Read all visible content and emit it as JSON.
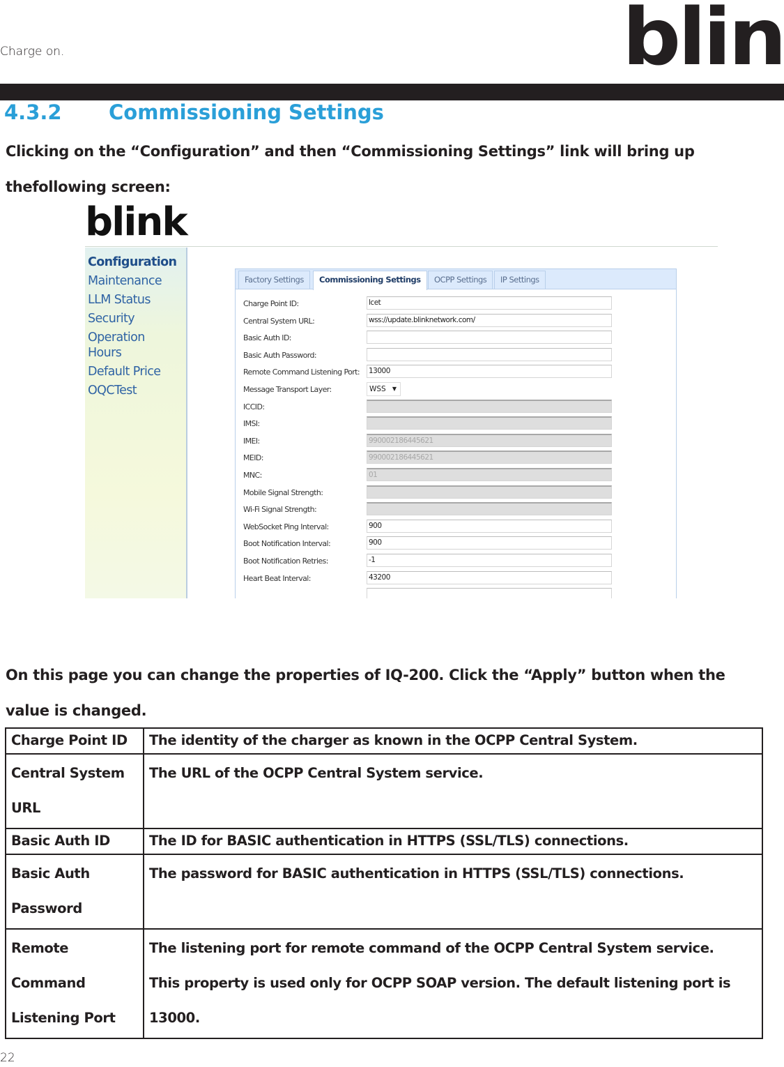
{
  "header": {
    "tagline": "Charge on.",
    "logo_text": "blink",
    "brand_color": "#2a9fd8",
    "bar_color": "#231f20"
  },
  "section": {
    "number": "4.3.2",
    "title": "Commissioning Settings"
  },
  "intro": {
    "line1": "Clicking on the “Configuration” and then “Commissioning Settings” link will bring up",
    "line2": "thefollowing screen:"
  },
  "screenshot": {
    "logo_text": "blink",
    "sidebar": {
      "items": [
        {
          "label": "Configuration",
          "active": true
        },
        {
          "label": "Maintenance"
        },
        {
          "label": "LLM Status"
        },
        {
          "label": "Security"
        },
        {
          "label": "Operation Hours"
        },
        {
          "label": "Default Price"
        },
        {
          "label": "OQCTest"
        }
      ]
    },
    "tabs": [
      {
        "label": "Factory Settings"
      },
      {
        "label": "Commissioning Settings",
        "active": true
      },
      {
        "label": "OCPP Settings"
      },
      {
        "label": "IP Settings"
      }
    ],
    "fields": [
      {
        "label": "Charge Point ID:",
        "value": "lcet",
        "disabled": false
      },
      {
        "label": "Central System URL:",
        "value": "wss://update.blinknetwork.com/",
        "disabled": false
      },
      {
        "label": "Basic Auth ID:",
        "value": "",
        "disabled": false
      },
      {
        "label": "Basic Auth Password:",
        "value": "",
        "disabled": false
      },
      {
        "label": "Remote Command Listening Port:",
        "value": "13000",
        "disabled": false
      },
      {
        "label": "Message Transport Layer:",
        "value": "WSS",
        "type": "select"
      },
      {
        "label": "ICCID:",
        "value": "",
        "disabled": true
      },
      {
        "label": "IMSI:",
        "value": "",
        "disabled": true
      },
      {
        "label": "IMEI:",
        "value": "990002186445621",
        "disabled": true
      },
      {
        "label": "MEID:",
        "value": "990002186445621",
        "disabled": true
      },
      {
        "label": "MNC:",
        "value": "01",
        "disabled": true
      },
      {
        "label": "Mobile Signal Strength:",
        "value": "",
        "disabled": true
      },
      {
        "label": "Wi-Fi Signal Strength:",
        "value": "",
        "disabled": true
      },
      {
        "label": "WebSocket Ping Interval:",
        "value": "900",
        "disabled": false
      },
      {
        "label": "Boot Notification Interval:",
        "value": "900",
        "disabled": false
      },
      {
        "label": "Boot Notification Retries:",
        "value": "-1",
        "disabled": false
      },
      {
        "label": "Heart Beat Interval:",
        "value": "43200",
        "disabled": false
      }
    ]
  },
  "body": {
    "line1": "On this page you can change the properties of IQ-200. Click the “Apply” button when the",
    "line2": "value is changed."
  },
  "table": {
    "rows": [
      {
        "key": [
          "Charge Point ID"
        ],
        "desc": [
          "The identity of the charger as known in the OCPP Central System."
        ]
      },
      {
        "key": [
          "Central System",
          "URL"
        ],
        "desc": [
          "The URL of the OCPP Central System service."
        ]
      },
      {
        "key": [
          "Basic Auth ID"
        ],
        "desc": [
          "The ID for BASIC authentication in HTTPS (SSL/TLS) connections."
        ]
      },
      {
        "key": [
          "Basic Auth",
          "Password"
        ],
        "desc": [
          "The password for BASIC authentication in HTTPS (SSL/TLS) connections."
        ]
      },
      {
        "key": [
          "Remote",
          "Command",
          "Listening Port"
        ],
        "desc": [
          "The listening port for remote command of the OCPP Central System service.",
          "This property is used only for OCPP SOAP version. The default listening port is",
          "13000."
        ]
      }
    ]
  },
  "footer": {
    "page_number": "22"
  }
}
